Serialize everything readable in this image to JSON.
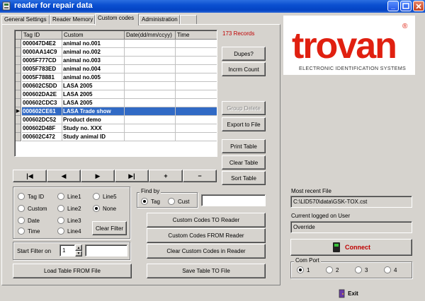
{
  "window": {
    "title": "reader for repair data"
  },
  "tabs": [
    {
      "label": "General Settings"
    },
    {
      "label": "Reader Memory"
    },
    {
      "label": "Custom codes"
    },
    {
      "label": "Administration"
    },
    {
      "label": ""
    }
  ],
  "table": {
    "headers": [
      "Tag ID",
      "Custom",
      "Date(dd/mm/ccyy)",
      "Time"
    ],
    "rows": [
      [
        "000047D4E2",
        "animal no.001",
        "",
        ""
      ],
      [
        "0000AA14C9",
        "animal no.002",
        "",
        ""
      ],
      [
        "0005F777CD",
        "animal no.003",
        "",
        ""
      ],
      [
        "0005F783ED",
        "animal no.004",
        "",
        ""
      ],
      [
        "0005F78881",
        "animal no.005",
        "",
        ""
      ],
      [
        "000602C5DD",
        "LASA 2005",
        "",
        ""
      ],
      [
        "000602DA2E",
        "LASA 2005",
        "",
        ""
      ],
      [
        "000602CDC3",
        "LASA 2005",
        "",
        ""
      ],
      [
        "000602CE61",
        "LASA Trade show",
        "",
        ""
      ],
      [
        "000602DC52",
        "Product demo",
        "",
        ""
      ],
      [
        "000602D48F",
        "Study no. XXX",
        "",
        ""
      ],
      [
        "000602C472",
        "Study  animal ID",
        "",
        ""
      ]
    ],
    "selected_row": 8
  },
  "records_count": "173 Records",
  "side_buttons": {
    "dupes": "Dupes?",
    "incrm_count": "Incrm Count",
    "group_delete": "Group Delete",
    "export_to_file": "Export to File",
    "print_table": "Print Table",
    "clear_table": "Clear Table",
    "sort_table": "Sort Table"
  },
  "nav": {
    "first": "|◀",
    "prev": "◀",
    "next": "▶",
    "last": "▶|",
    "add": "+",
    "remove": "−"
  },
  "filter": {
    "options": [
      {
        "label": "Tag ID",
        "checked": false
      },
      {
        "label": "Line1",
        "checked": false
      },
      {
        "label": "Line5",
        "checked": false
      },
      {
        "label": "Custom",
        "checked": false
      },
      {
        "label": "Line2",
        "checked": false
      },
      {
        "label": "None",
        "checked": true
      },
      {
        "label": "Date",
        "checked": false
      },
      {
        "label": "Line3",
        "checked": false
      },
      {
        "label": "Time",
        "checked": false
      },
      {
        "label": "Line4",
        "checked": false
      }
    ],
    "clear_filter": "Clear Filter",
    "start_label": "Start Filter on",
    "start_value": "1",
    "start_text": ""
  },
  "find_by": {
    "label": "Find by",
    "options": [
      {
        "label": "Tag",
        "checked": true
      },
      {
        "label": "Cust",
        "checked": false
      }
    ],
    "value": ""
  },
  "custom_buttons": {
    "to_reader": "Custom Codes TO Reader",
    "from_reader": "Custom Codes FROM Reader",
    "clear_in_reader": "Clear Custom Codes in Reader"
  },
  "bottom_buttons": {
    "load": "Load Table FROM File",
    "save": "Save Table TO File"
  },
  "logo": {
    "name": "trovan",
    "registered": "®",
    "tagline": "ELECTRONIC IDENTIFICATION SYSTEMS",
    "color": "#e02010"
  },
  "right_panel": {
    "recent_label": "Most recent File",
    "recent_value": "C:\\LID570\\data\\GSK-TOX.cst",
    "user_label": "Current logged on User",
    "user_value": "Override",
    "connect": "Connect",
    "connect_color": "#c00000",
    "com_label": "Com Port",
    "com_options": [
      {
        "label": "1",
        "checked": true
      },
      {
        "label": "2",
        "checked": false
      },
      {
        "label": "3",
        "checked": false
      },
      {
        "label": "4",
        "checked": false
      }
    ]
  },
  "exit": "Exit"
}
